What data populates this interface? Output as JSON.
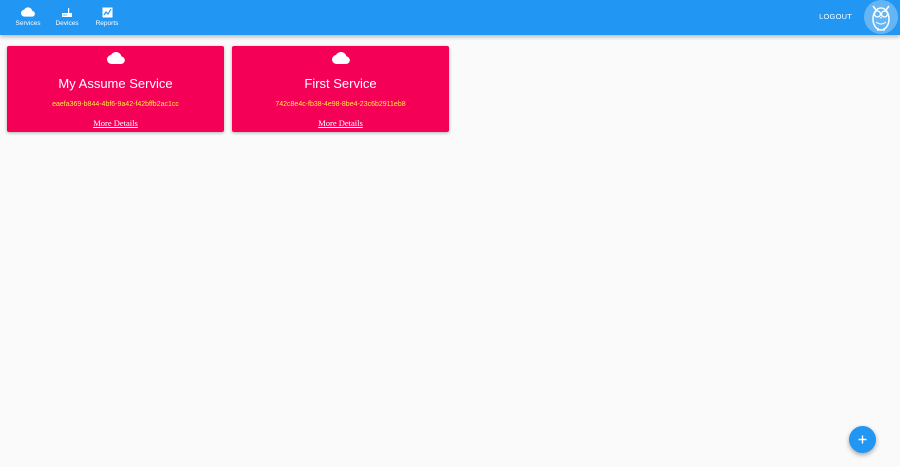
{
  "nav": {
    "items": [
      {
        "label": "Services",
        "icon": "cloud-icon"
      },
      {
        "label": "Devices",
        "icon": "router-icon"
      },
      {
        "label": "Reports",
        "icon": "chart-icon"
      }
    ],
    "logout_label": "LOGOUT"
  },
  "services": [
    {
      "name": "My Assume Service",
      "id": "eaefa369-b844-4bf6-9a42-f42bffb2ac1cc",
      "link": "More Details"
    },
    {
      "name": "First Service",
      "id": "742c8e4c-fb38-4e98-8be4-23c6b2911eb8",
      "link": "More Details"
    }
  ],
  "colors": {
    "appbar": "#2196f3",
    "card": "#f50057",
    "card_id": "#ffeb3b",
    "fab": "#2196f3"
  },
  "fab": {
    "icon": "plus-icon"
  }
}
